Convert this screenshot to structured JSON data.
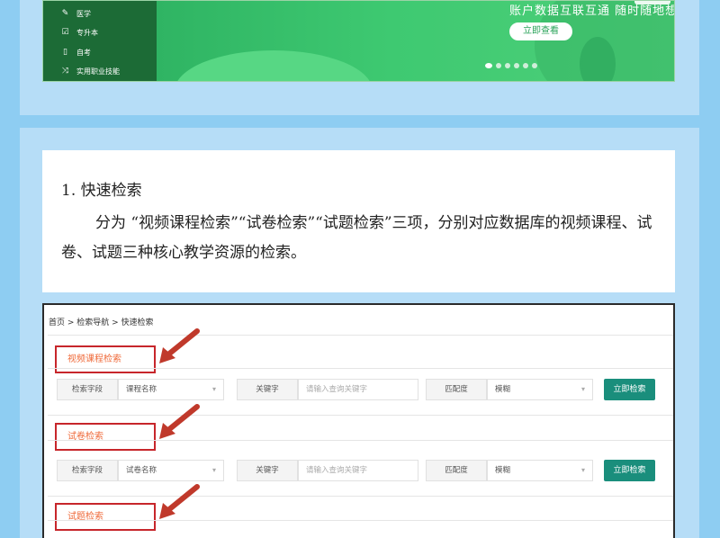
{
  "banner": {
    "menu_items": [
      {
        "label": "医学",
        "icon": "pencil-icon"
      },
      {
        "label": "专升本",
        "icon": "edit-doc-icon"
      },
      {
        "label": "自考",
        "icon": "document-icon"
      },
      {
        "label": "实用职业技能",
        "icon": "shuffle-icon"
      }
    ],
    "tagline": "账户数据互联互通 随时随地想学就学",
    "view_button": "立即查看",
    "carousel_dots": 6,
    "active_dot": 0,
    "colors": {
      "side": "#1c6b36",
      "main": "#3cc46b",
      "button_text": "#2aa35a"
    }
  },
  "article": {
    "heading": "1. 快速检索",
    "paragraph": "分为 “视频课程检索”“试卷检索”“试题检索”三项，分别对应数据库的视频课程、试卷、试题三种核心教学资源的检索。"
  },
  "screenshot": {
    "breadcrumb": "首页 > 检索导航 > 快速检索",
    "sections": [
      {
        "title": "视频课程检索",
        "field_label": "检索字段",
        "field_value": "课程名称",
        "keyword_label": "关键字",
        "keyword_placeholder": "请输入查询关键字",
        "match_label": "匹配度",
        "match_value": "模糊",
        "button": "立即检索"
      },
      {
        "title": "试卷检索",
        "field_label": "检索字段",
        "field_value": "试卷名称",
        "keyword_label": "关键字",
        "keyword_placeholder": "请输入查询关键字",
        "match_label": "匹配度",
        "match_value": "模糊",
        "button": "立即检索"
      },
      {
        "title": "试题检索"
      }
    ],
    "colors": {
      "highlight_box": "#c7262b",
      "section_title": "#ef6a3a",
      "search_button": "#1a8e7c",
      "arrow": "#c0392b"
    }
  }
}
